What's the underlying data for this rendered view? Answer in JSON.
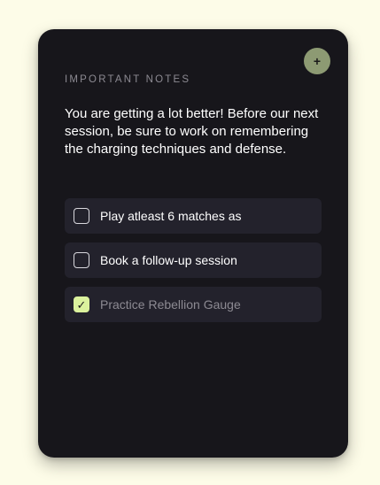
{
  "card": {
    "add_button_label": "+",
    "section_title": "IMPORTANT NOTES",
    "note_text": "You are getting a lot better! Before our next session, be sure to work on remembering the charging techniques and defense."
  },
  "todos": [
    {
      "label": "Play atleast 6 matches as",
      "checked": false
    },
    {
      "label": "Book a follow-up session",
      "checked": false
    },
    {
      "label": "Practice Rebellion Gauge",
      "checked": true
    }
  ],
  "check_glyph": "✓",
  "colors": {
    "page_background": "#fdfce8",
    "card_background": "#17161b",
    "item_background": "#23222c",
    "add_button": "#8d9a73",
    "check_accent": "#dbf29d"
  }
}
